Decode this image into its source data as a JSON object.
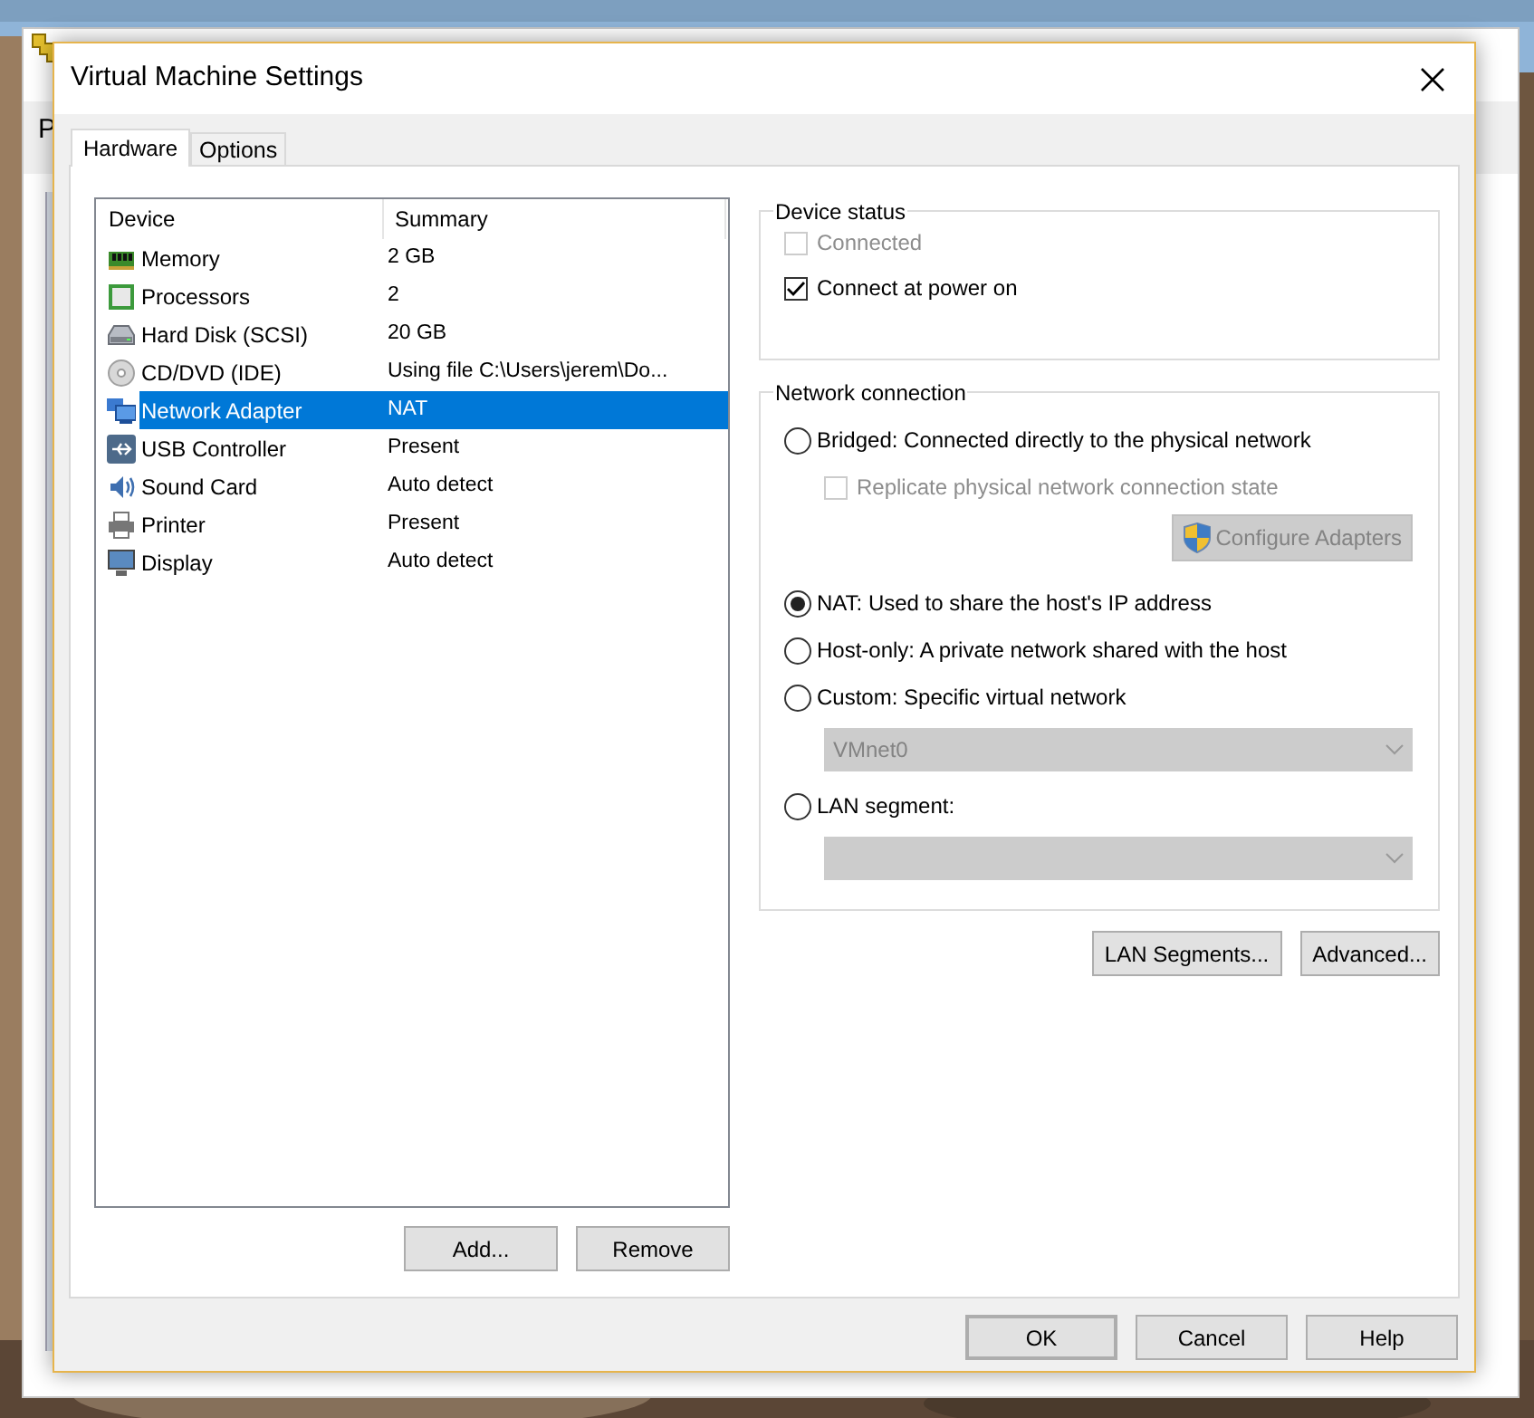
{
  "parent_window": {
    "visible_text": "P"
  },
  "dialog": {
    "title": "Virtual Machine Settings"
  },
  "tabs": [
    {
      "label": "Hardware",
      "selected": true
    },
    {
      "label": "Options",
      "selected": false
    }
  ],
  "device_table": {
    "columns": [
      "Device",
      "Summary"
    ],
    "rows": [
      {
        "kind": "memory",
        "device": "Memory",
        "summary": "2 GB",
        "selected": false
      },
      {
        "kind": "processor",
        "device": "Processors",
        "summary": "2",
        "selected": false
      },
      {
        "kind": "disk",
        "device": "Hard Disk (SCSI)",
        "summary": "20 GB",
        "selected": false
      },
      {
        "kind": "cd",
        "device": "CD/DVD (IDE)",
        "summary": "Using file C:\\Users\\jerem\\Do...",
        "selected": false
      },
      {
        "kind": "network",
        "device": "Network Adapter",
        "summary": "NAT",
        "selected": true
      },
      {
        "kind": "usb",
        "device": "USB Controller",
        "summary": "Present",
        "selected": false
      },
      {
        "kind": "sound",
        "device": "Sound Card",
        "summary": "Auto detect",
        "selected": false
      },
      {
        "kind": "printer",
        "device": "Printer",
        "summary": "Present",
        "selected": false
      },
      {
        "kind": "display",
        "device": "Display",
        "summary": "Auto detect",
        "selected": false
      }
    ]
  },
  "list_buttons": [
    "Add...",
    "Remove"
  ],
  "device_status": {
    "title": "Device status",
    "options": [
      {
        "label": "Connected",
        "checked": false,
        "disabled": true
      },
      {
        "label": "Connect at power on",
        "checked": true,
        "disabled": false
      }
    ]
  },
  "network_connection": {
    "title": "Network connection",
    "items": [
      {
        "kind": "radio",
        "label": "Bridged: Connected directly to the physical network",
        "selected": false
      },
      {
        "kind": "checkbox",
        "label": "Replicate physical network connection state",
        "checked": false,
        "disabled": true
      },
      {
        "kind": "button",
        "label": "Configure Adapters",
        "disabled": true
      },
      {
        "kind": "radio",
        "label": "NAT: Used to share the host's IP address",
        "selected": true
      },
      {
        "kind": "radio",
        "label": "Host-only: A private network shared with the host",
        "selected": false
      },
      {
        "kind": "radio",
        "label": "Custom: Specific virtual network",
        "selected": false
      },
      {
        "kind": "dropdown",
        "value": "VMnet0",
        "disabled": true
      },
      {
        "kind": "radio",
        "label": "LAN segment:",
        "selected": false
      },
      {
        "kind": "dropdown",
        "disabled": true
      }
    ]
  },
  "network_buttons": [
    "LAN Segments...",
    "Advanced..."
  ],
  "dialog_buttons": [
    {
      "label": "OK",
      "default": true
    },
    {
      "label": "Cancel",
      "default": false
    },
    {
      "label": "Help",
      "default": false
    }
  ]
}
